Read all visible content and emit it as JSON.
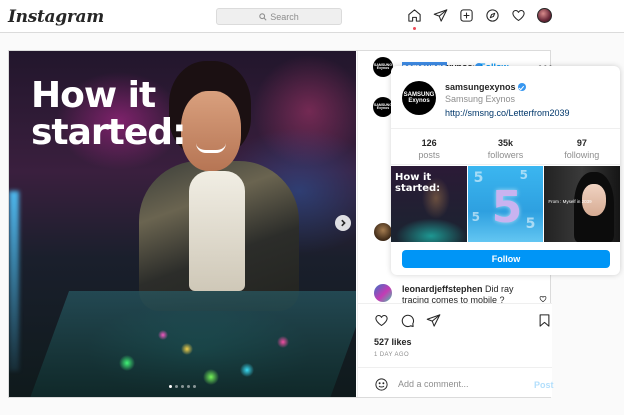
{
  "nav": {
    "logo": "Instagram",
    "search_placeholder": "Search"
  },
  "post": {
    "username": "samsungexynos",
    "username_selected": "samsunge",
    "username_rest": "xynos",
    "separator": "•",
    "follow": "Follow",
    "more": "•••",
    "photo_text": "How it\nstarted:",
    "likes": "527 likes",
    "time_ago": "1 DAY AGO",
    "comment": {
      "user": "leonardjeffstephen",
      "text": "Did ray tracing comes to mobile ?"
    },
    "add_comment_placeholder": "Add a comment...",
    "post_button": "Post",
    "brand_logo_line1": "SAMSUNG",
    "brand_logo_line2": "Exynos"
  },
  "hovercard": {
    "username": "samsungexynos",
    "display_name": "Samsung Exynos",
    "link": "http://smsng.co/Letterfrom2039",
    "stats": [
      {
        "value": "126",
        "label": "posts"
      },
      {
        "value": "35k",
        "label": "followers"
      },
      {
        "value": "97",
        "label": "following"
      }
    ],
    "thumb1_text": "How it\nstarted:",
    "thumb2_number": "5",
    "thumb3_text": "From : Myself in 2039",
    "follow_button": "Follow"
  },
  "colors": {
    "accent": "#0095f6",
    "verified": "#3897f0",
    "selection": "#3e8ae3",
    "notification": "#ed4956"
  },
  "icons": [
    "home-icon",
    "direct-icon",
    "new-post-icon",
    "explore-icon",
    "activity-heart-icon",
    "search-icon",
    "like-icon",
    "comment-icon",
    "share-icon",
    "save-icon",
    "emoji-icon",
    "next-arrow-icon",
    "verified-icon"
  ]
}
